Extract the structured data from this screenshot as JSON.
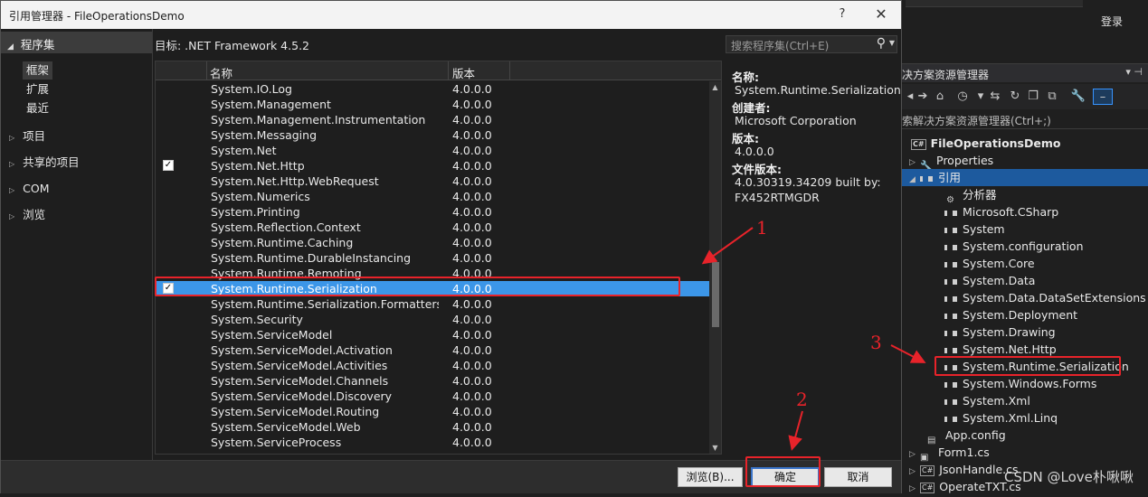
{
  "background": {
    "login": "登录",
    "solution_explorer": {
      "title": "决方案资源管理器",
      "search_placeholder": "索解决方案资源管理器(Ctrl+;)",
      "solution_name": "FileOperationsDemo",
      "items": [
        {
          "label": "Properties"
        },
        {
          "label": "引用"
        },
        {
          "label": "分析器"
        },
        {
          "label": "Microsoft.CSharp"
        },
        {
          "label": "System"
        },
        {
          "label": "System.configuration"
        },
        {
          "label": "System.Core"
        },
        {
          "label": "System.Data"
        },
        {
          "label": "System.Data.DataSetExtensions"
        },
        {
          "label": "System.Deployment"
        },
        {
          "label": "System.Drawing"
        },
        {
          "label": "System.Net.Http"
        },
        {
          "label": "System.Runtime.Serialization"
        },
        {
          "label": "System.Windows.Forms"
        },
        {
          "label": "System.Xml"
        },
        {
          "label": "System.Xml.Linq"
        },
        {
          "label": "App.config"
        },
        {
          "label": "Form1.cs"
        },
        {
          "label": "JsonHandle.cs"
        },
        {
          "label": "OperateTXT.cs"
        }
      ]
    },
    "watermark": "CSDN @Love朴啾啾"
  },
  "dialog": {
    "title": "引用管理器 - FileOperationsDemo",
    "help": "?",
    "close": "✕",
    "nav": {
      "assemblies": "程序集",
      "framework": "框架",
      "extensions": "扩展",
      "recent": "最近",
      "projects": "项目",
      "shared_projects": "共享的项目",
      "com": "COM",
      "browse": "浏览"
    },
    "target": "目标: .NET Framework 4.5.2",
    "search_placeholder": "搜索程序集(Ctrl+E)",
    "columns": {
      "name": "名称",
      "version": "版本"
    },
    "rows": [
      {
        "name": "System.IO.Log",
        "version": "4.0.0.0",
        "checked": false
      },
      {
        "name": "System.Management",
        "version": "4.0.0.0",
        "checked": false
      },
      {
        "name": "System.Management.Instrumentation",
        "version": "4.0.0.0",
        "checked": false
      },
      {
        "name": "System.Messaging",
        "version": "4.0.0.0",
        "checked": false
      },
      {
        "name": "System.Net",
        "version": "4.0.0.0",
        "checked": false
      },
      {
        "name": "System.Net.Http",
        "version": "4.0.0.0",
        "checked": true
      },
      {
        "name": "System.Net.Http.WebRequest",
        "version": "4.0.0.0",
        "checked": false
      },
      {
        "name": "System.Numerics",
        "version": "4.0.0.0",
        "checked": false
      },
      {
        "name": "System.Printing",
        "version": "4.0.0.0",
        "checked": false
      },
      {
        "name": "System.Reflection.Context",
        "version": "4.0.0.0",
        "checked": false
      },
      {
        "name": "System.Runtime.Caching",
        "version": "4.0.0.0",
        "checked": false
      },
      {
        "name": "System.Runtime.DurableInstancing",
        "version": "4.0.0.0",
        "checked": false
      },
      {
        "name": "System.Runtime.Remoting",
        "version": "4.0.0.0",
        "checked": false
      },
      {
        "name": "System.Runtime.Serialization",
        "version": "4.0.0.0",
        "checked": true,
        "selected": true
      },
      {
        "name": "System.Runtime.Serialization.Formatters.S...",
        "version": "4.0.0.0",
        "checked": false
      },
      {
        "name": "System.Security",
        "version": "4.0.0.0",
        "checked": false
      },
      {
        "name": "System.ServiceModel",
        "version": "4.0.0.0",
        "checked": false
      },
      {
        "name": "System.ServiceModel.Activation",
        "version": "4.0.0.0",
        "checked": false
      },
      {
        "name": "System.ServiceModel.Activities",
        "version": "4.0.0.0",
        "checked": false
      },
      {
        "name": "System.ServiceModel.Channels",
        "version": "4.0.0.0",
        "checked": false
      },
      {
        "name": "System.ServiceModel.Discovery",
        "version": "4.0.0.0",
        "checked": false
      },
      {
        "name": "System.ServiceModel.Routing",
        "version": "4.0.0.0",
        "checked": false
      },
      {
        "name": "System.ServiceModel.Web",
        "version": "4.0.0.0",
        "checked": false
      },
      {
        "name": "System.ServiceProcess",
        "version": "4.0.0.0",
        "checked": false
      }
    ],
    "details": {
      "name_label": "名称:",
      "name_value": "System.Runtime.Serialization",
      "creator_label": "创建者:",
      "creator_value": "Microsoft Corporation",
      "version_label": "版本:",
      "version_value": "4.0.0.0",
      "file_version_label": "文件版本:",
      "file_version_value_1": "4.0.30319.34209 built by:",
      "file_version_value_2": "FX452RTMGDR"
    },
    "buttons": {
      "browse": "浏览(B)...",
      "ok": "确定",
      "cancel": "取消"
    }
  },
  "annotations": {
    "one": "1",
    "two": "2",
    "three": "3",
    "color": "#e8232a"
  }
}
